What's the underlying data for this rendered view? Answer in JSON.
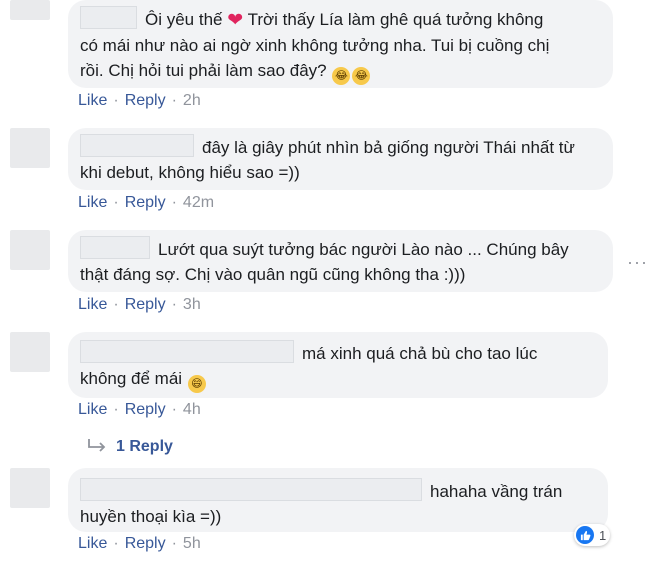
{
  "comments": [
    {
      "lines": [
        "Ôi yêu thế",
        "Trời thấy Lía làm ghê quá tưởng không",
        "có mái như nào ai ngờ xinh không tưởng nha. Tui bị cuồng chị",
        "rồi. Chị hỏi tui phải làm sao đây?"
      ],
      "like": "Like",
      "reply": "Reply",
      "time": "2h"
    },
    {
      "lines": [
        "đây là giây phút nhìn bả giống người Thái nhất từ",
        "khi debut, không hiểu sao =))"
      ],
      "like": "Like",
      "reply": "Reply",
      "time": "42m"
    },
    {
      "lines": [
        "Lướt qua suýt tưởng bác người Lào nào ... Chúng bây",
        "thật đáng sợ. Chị vào quân ngũ cũng không tha :)))"
      ],
      "like": "Like",
      "reply": "Reply",
      "time": "3h"
    },
    {
      "lines": [
        "má xinh quá chả bù cho tao lúc",
        "không để mái"
      ],
      "like": "Like",
      "reply": "Reply",
      "time": "4h"
    },
    {
      "lines": [
        "hahaha vầng trán",
        "huyền thoại kìa =))"
      ],
      "like": "Like",
      "reply": "Reply",
      "time": "5h"
    }
  ],
  "replies_link": "1 Reply",
  "reaction_count": "1",
  "dot_separator": "·",
  "colors": {
    "link": "#385898",
    "bubble": "#f2f3f5",
    "like_blue": "#1877f2"
  },
  "icons": [
    "heart-icon",
    "crying-laughing-emoji",
    "grinning-emoji",
    "reply-arrow-icon",
    "like-reaction-icon",
    "more-options-icon"
  ]
}
